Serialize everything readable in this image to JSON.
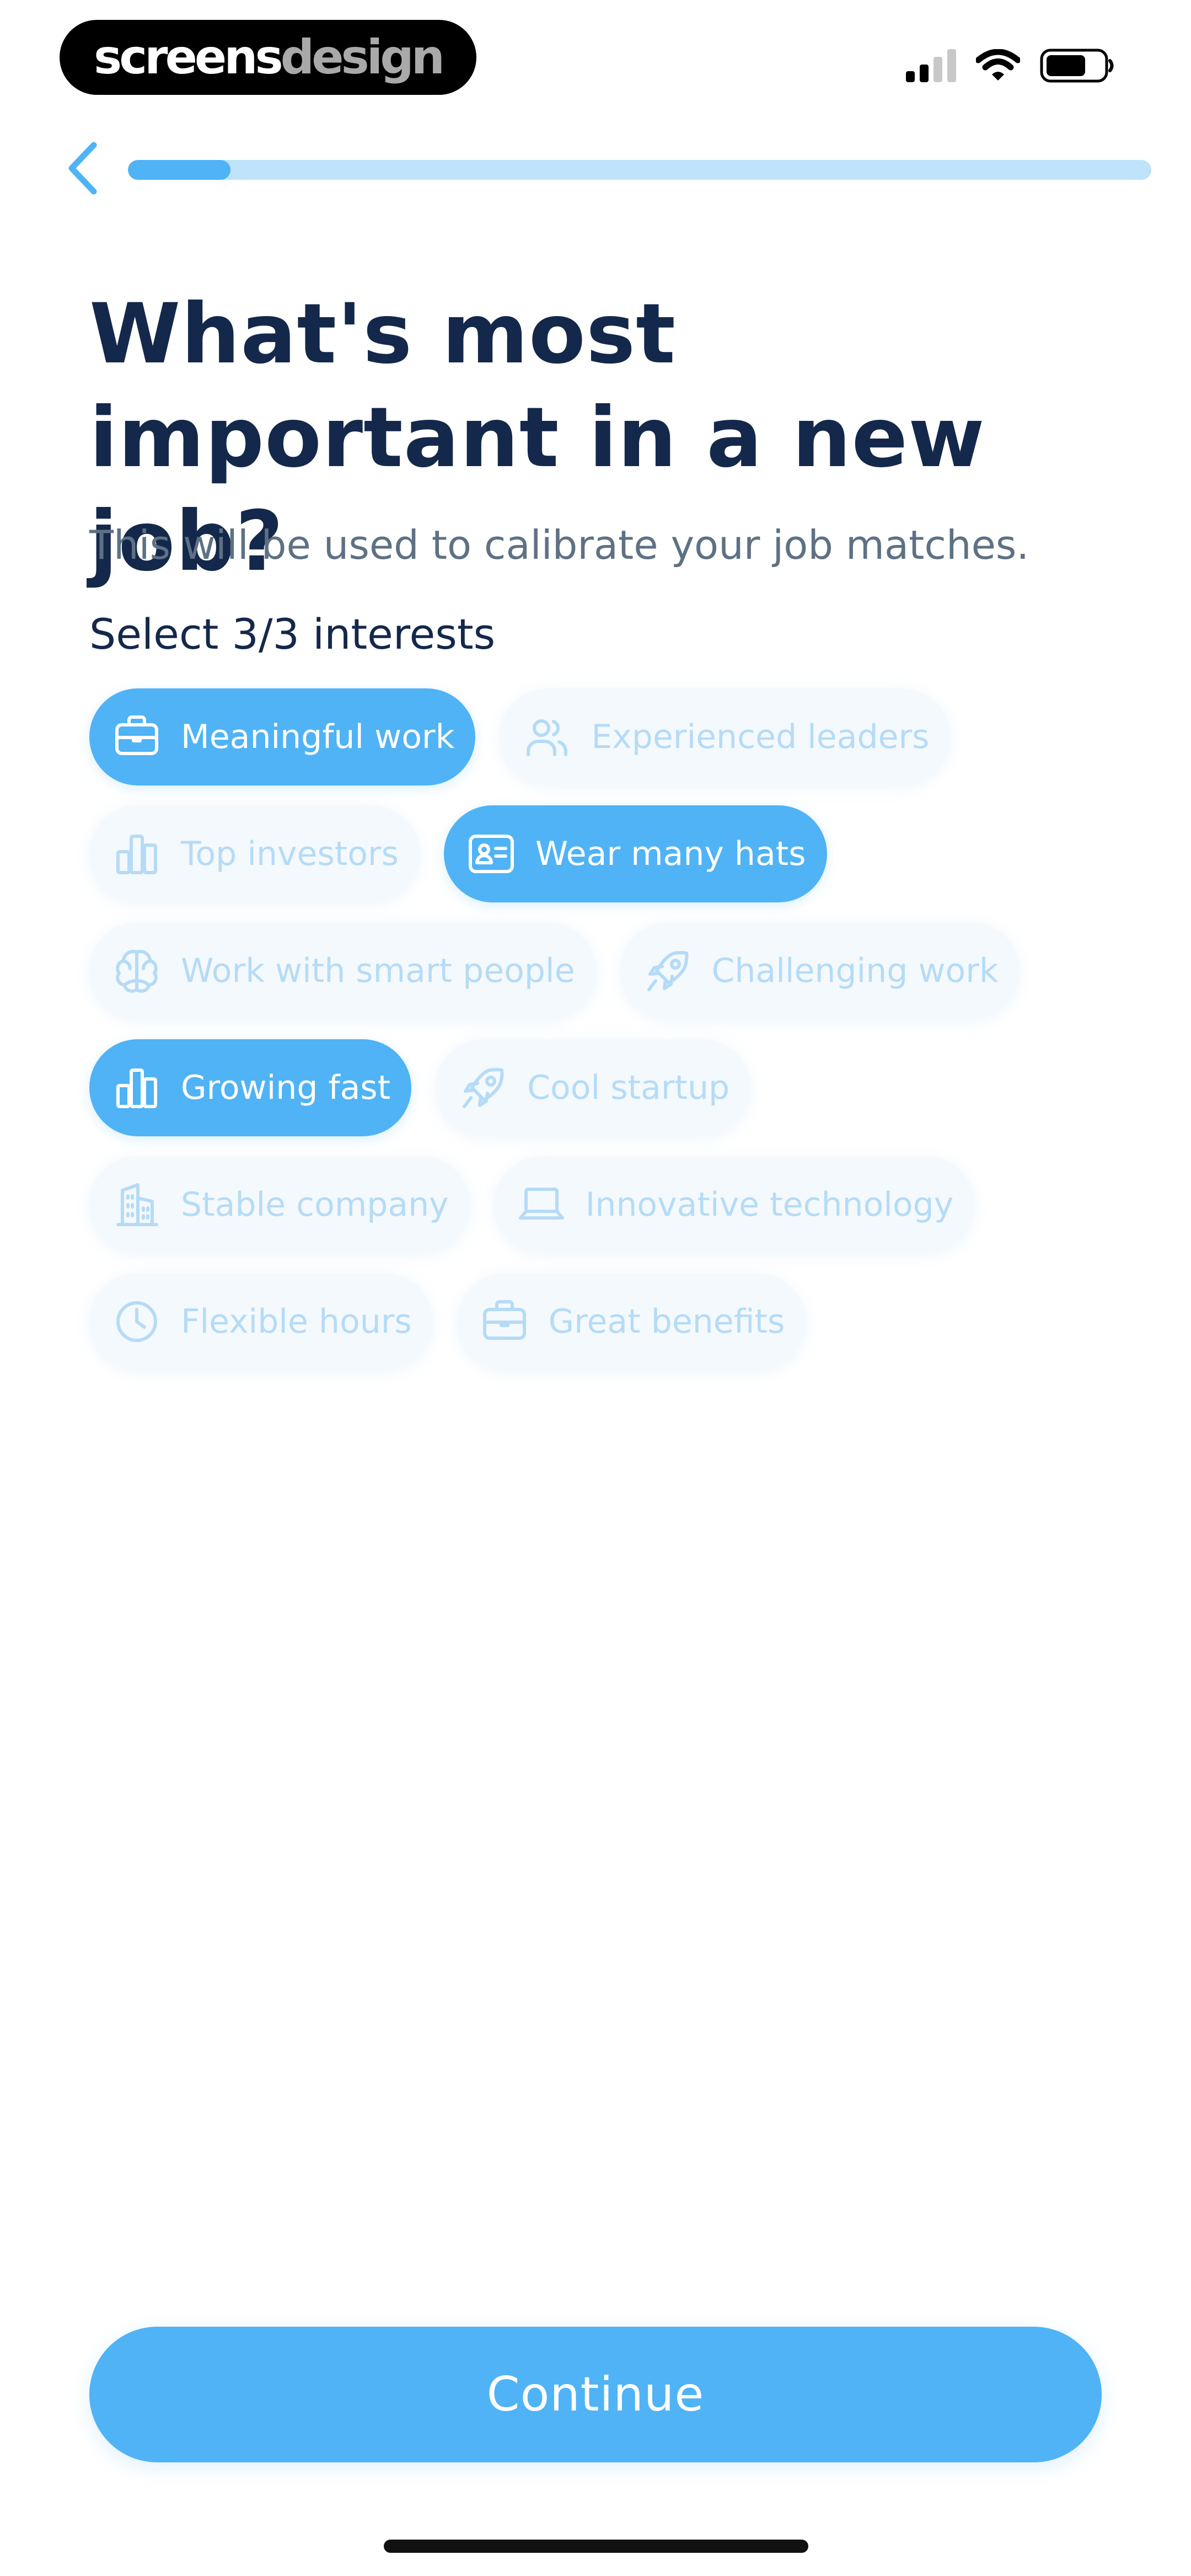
{
  "status_bar": {
    "brand_part1": "screens",
    "brand_part2": "design",
    "icons": [
      "cellular-signal-icon",
      "wifi-icon",
      "battery-icon"
    ]
  },
  "nav": {
    "back_icon": "chevron-left-icon",
    "progress_fraction": 0.1
  },
  "header": {
    "title": "What's most important in a new job?",
    "subtitle": "This will be used to calibrate your job matches.",
    "select_count": "Select 3/3 interests"
  },
  "interests": [
    {
      "label": "Meaningful work",
      "icon": "briefcase-icon",
      "selected": true
    },
    {
      "label": "Experienced leaders",
      "icon": "users-icon",
      "selected": false
    },
    {
      "label": "Top investors",
      "icon": "bar-chart-icon",
      "selected": false
    },
    {
      "label": "Wear many hats",
      "icon": "id-card-icon",
      "selected": true
    },
    {
      "label": "Work with smart people",
      "icon": "brain-icon",
      "selected": false
    },
    {
      "label": "Challenging work",
      "icon": "rocket-icon",
      "selected": false
    },
    {
      "label": "Growing fast",
      "icon": "bar-chart-icon",
      "selected": true
    },
    {
      "label": "Cool startup",
      "icon": "rocket-icon",
      "selected": false
    },
    {
      "label": "Stable company",
      "icon": "building-icon",
      "selected": false
    },
    {
      "label": "Innovative technology",
      "icon": "laptop-icon",
      "selected": false
    },
    {
      "label": "Flexible hours",
      "icon": "clock-icon",
      "selected": false
    },
    {
      "label": "Great benefits",
      "icon": "briefcase-icon",
      "selected": false
    }
  ],
  "footer": {
    "continue_label": "Continue"
  },
  "colors": {
    "accent": "#4FB3F6",
    "accent_light": "#BEE3FB",
    "title": "#14284B",
    "subtitle": "#5E7184",
    "chip_unselected_bg": "#F4F9FE",
    "chip_unselected_text": "#B5DBF6"
  }
}
